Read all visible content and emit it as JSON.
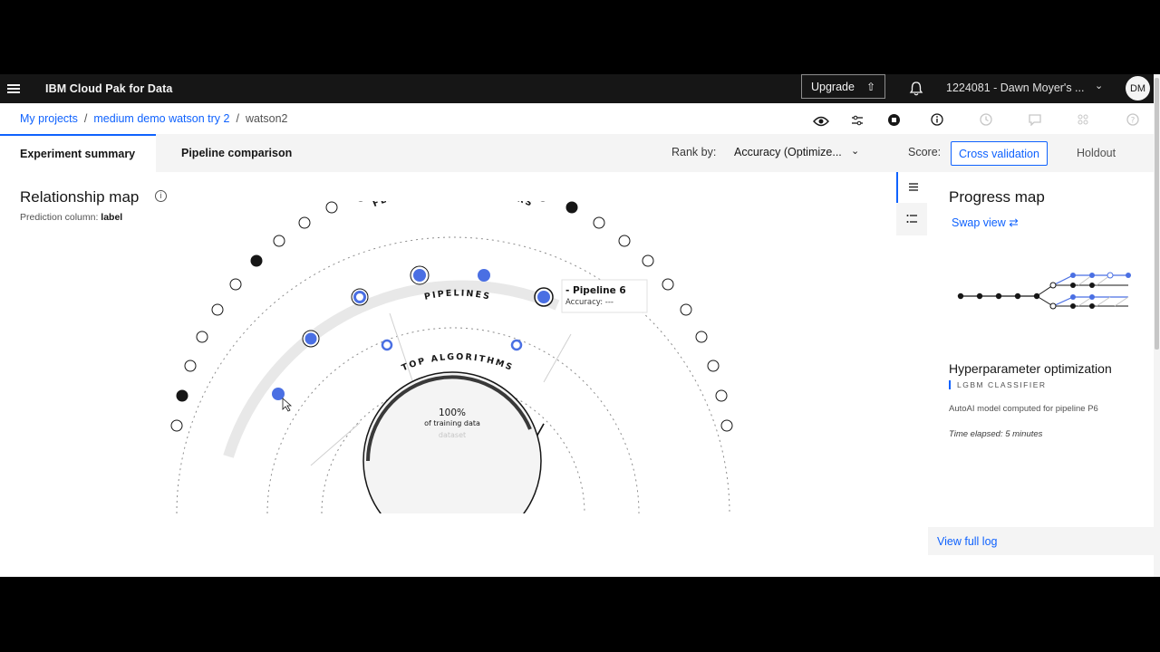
{
  "header": {
    "menu_icon": "hamburger-icon",
    "brand": "IBM Cloud Pak for Data",
    "upgrade_label": "Upgrade",
    "account": "1224081 - Dawn Moyer's ...",
    "avatar": "DM"
  },
  "breadcrumb": {
    "items": [
      "My projects",
      "medium demo watson try 2",
      "watson2"
    ],
    "separator": "/"
  },
  "toolbar_icons": [
    "eye-icon",
    "settings-adjust-icon",
    "stop-icon",
    "info-icon",
    "history-icon",
    "chat-icon",
    "deploy-icon",
    "help-icon"
  ],
  "tabs": {
    "summary": "Experiment summary",
    "comparison": "Pipeline comparison"
  },
  "rank": {
    "label": "Rank by:",
    "value": "Accuracy (Optimize..."
  },
  "score": {
    "label": "Score:",
    "cross_validation": "Cross validation",
    "holdout": "Holdout"
  },
  "relationship_map": {
    "title": "Relationship map",
    "prediction_label": "Prediction column:",
    "prediction_value": "label",
    "ring_labels": {
      "feature": "FEATURE TRANSFORMERS",
      "pipelines": "PIPELINES",
      "algorithms": "TOP ALGORITHMS"
    },
    "tooltip": {
      "title": "- Pipeline 6",
      "accuracy": "Accuracy: ---"
    },
    "center": {
      "percent": "100%",
      "sub": "of training data",
      "faint": "dataset"
    }
  },
  "progress_map": {
    "title": "Progress map",
    "swap_label": "Swap view",
    "phase": "Hyperparameter optimization",
    "classifier": "LGBM CLASSIFIER",
    "detail": "AutoAI model computed for pipeline P6",
    "elapsed": "Time elapsed: 5 minutes",
    "log_link": "View full log"
  },
  "colors": {
    "accent": "#0f62fe",
    "node_blue": "#4a6fe3",
    "topbar": "#161616"
  }
}
